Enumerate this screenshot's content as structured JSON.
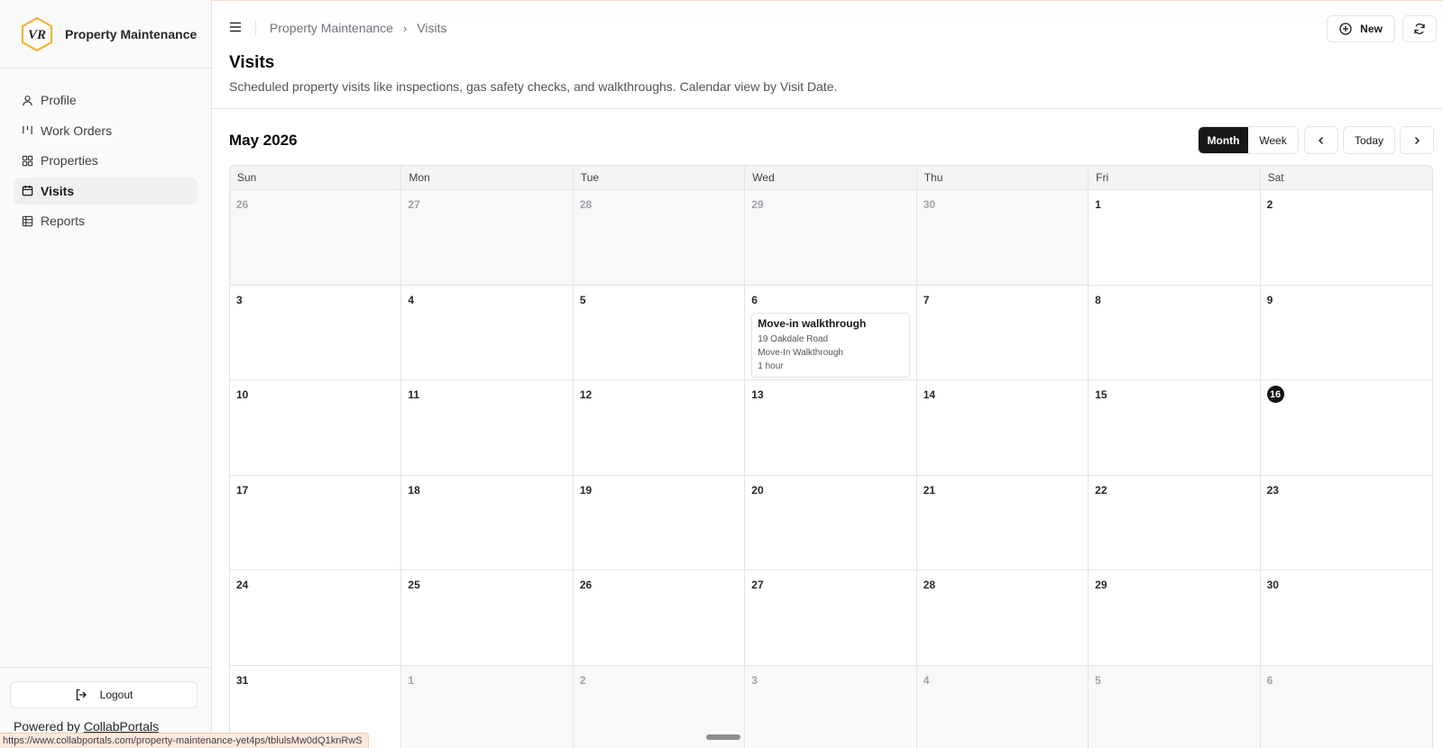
{
  "sidebar": {
    "brand_name": "Property Maintenance",
    "brand_logo_text": "VR",
    "items": [
      {
        "label": "Profile",
        "icon": "user-icon"
      },
      {
        "label": "Work Orders",
        "icon": "kanban-icon"
      },
      {
        "label": "Properties",
        "icon": "grid-icon"
      },
      {
        "label": "Visits",
        "icon": "calendar-icon",
        "active": true
      },
      {
        "label": "Reports",
        "icon": "table-icon"
      }
    ],
    "logout_label": "Logout",
    "powered_prefix": "Powered by",
    "powered_link": "CollabPortals"
  },
  "status_url": "https://www.collabportals.com/property-maintenance-yet4ps/tblulsMw0dQ1knRwS",
  "header": {
    "breadcrumb": [
      "Property Maintenance",
      "Visits"
    ],
    "new_label": "New"
  },
  "page": {
    "title": "Visits",
    "description": "Scheduled property visits like inspections, gas safety checks, and walkthroughs. Calendar view by Visit Date."
  },
  "calendar": {
    "month_title": "May 2026",
    "view_options": [
      "Month",
      "Week"
    ],
    "active_view": "Month",
    "today_label": "Today",
    "weekdays": [
      "Sun",
      "Mon",
      "Tue",
      "Wed",
      "Thu",
      "Fri",
      "Sat"
    ],
    "today": 16,
    "days": [
      {
        "d": "26",
        "m": true
      },
      {
        "d": "27",
        "m": true
      },
      {
        "d": "28",
        "m": true
      },
      {
        "d": "29",
        "m": true
      },
      {
        "d": "30",
        "m": true
      },
      {
        "d": "1"
      },
      {
        "d": "2"
      },
      {
        "d": "3"
      },
      {
        "d": "4"
      },
      {
        "d": "5"
      },
      {
        "d": "6"
      },
      {
        "d": "7"
      },
      {
        "d": "8"
      },
      {
        "d": "9"
      },
      {
        "d": "10"
      },
      {
        "d": "11"
      },
      {
        "d": "12"
      },
      {
        "d": "13"
      },
      {
        "d": "14"
      },
      {
        "d": "15"
      },
      {
        "d": "16",
        "today": true
      },
      {
        "d": "17"
      },
      {
        "d": "18"
      },
      {
        "d": "19"
      },
      {
        "d": "20"
      },
      {
        "d": "21"
      },
      {
        "d": "22"
      },
      {
        "d": "23"
      },
      {
        "d": "24"
      },
      {
        "d": "25"
      },
      {
        "d": "26"
      },
      {
        "d": "27"
      },
      {
        "d": "28"
      },
      {
        "d": "29"
      },
      {
        "d": "30"
      },
      {
        "d": "31"
      },
      {
        "d": "1",
        "m": true
      },
      {
        "d": "2",
        "m": true
      },
      {
        "d": "3",
        "m": true
      },
      {
        "d": "4",
        "m": true
      },
      {
        "d": "5",
        "m": true
      },
      {
        "d": "6",
        "m": true
      }
    ],
    "events": [
      {
        "day_index": 10,
        "title": "Move-in walkthrough",
        "property": "19 Oakdale Road",
        "type": "Move-In Walkthrough",
        "duration": "1 hour"
      }
    ]
  },
  "colors": {
    "accent": "#18181b",
    "brand_hex": "#f2b33d",
    "border": "#e4e4e7"
  }
}
